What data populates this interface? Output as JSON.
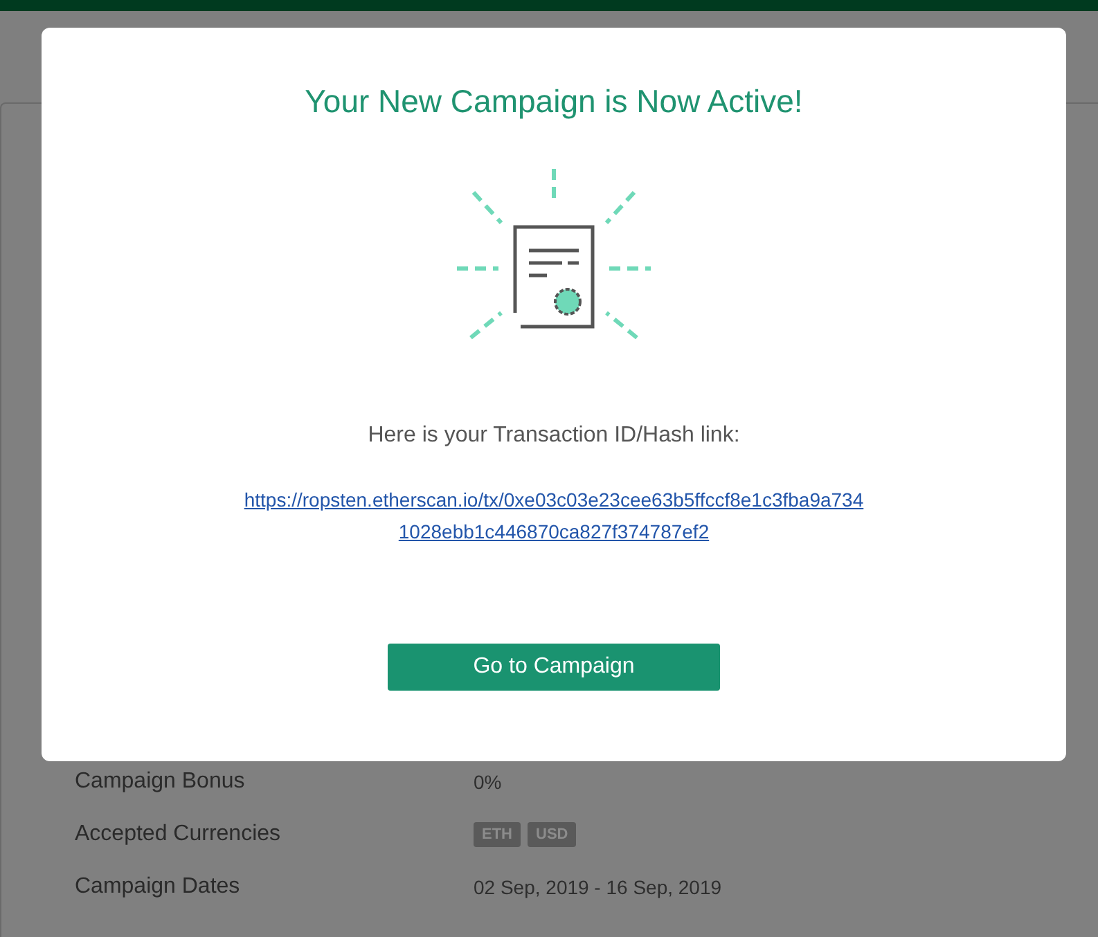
{
  "modal": {
    "title": "Your New Campaign is Now Active!",
    "message": "Here is your Transaction ID/Hash link:",
    "link": "https://ropsten.etherscan.io/tx/0xe03c03e23cee63b5ffccf8e1c3fba9a7341028ebb1c446870ca827f374787ef2",
    "button": "Go to Campaign"
  },
  "details": [
    {
      "label": "Campaign Bonus",
      "kind": "text",
      "value": "0%"
    },
    {
      "label": "Accepted Currencies",
      "kind": "tags",
      "tags": [
        "ETH",
        "USD"
      ]
    },
    {
      "label": "Campaign Dates",
      "kind": "text",
      "value": "02 Sep, 2019 - 16 Sep, 2019"
    }
  ]
}
